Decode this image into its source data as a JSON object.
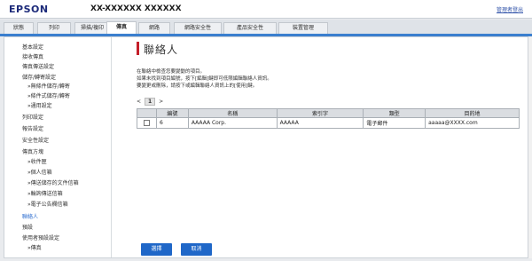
{
  "header": {
    "brand": "EPSON",
    "model": "XX-XXXXXX XXXXXX",
    "logout": "管理者登出"
  },
  "tabs": [
    {
      "label": "狀態"
    },
    {
      "label": "列印"
    },
    {
      "label": "掃描/複印"
    },
    {
      "label": "傳真"
    },
    {
      "label": "網路"
    },
    {
      "label": "網路安全性"
    },
    {
      "label": "產品安全性"
    },
    {
      "label": "裝置管理"
    }
  ],
  "sidebar": {
    "items": [
      {
        "label": "基本設定"
      },
      {
        "label": "接收傳真"
      },
      {
        "label": "傳真傳送設定"
      },
      {
        "label": "儲存/轉寄設定"
      },
      {
        "label": "»無條件儲存/轉寄"
      },
      {
        "label": "»條件式儲存/轉寄"
      },
      {
        "label": "»通用設定"
      },
      {
        "label": "列印設定"
      },
      {
        "label": "報告設定"
      },
      {
        "label": "安全性設定"
      },
      {
        "label": "傳真方塊"
      },
      {
        "label": "»收件匣"
      },
      {
        "label": "»個人信箱"
      },
      {
        "label": "»傳送儲存的文件信箱"
      },
      {
        "label": "»輪詢傳送信箱"
      },
      {
        "label": "»電子公告欄信箱"
      },
      {
        "label": "聯絡人"
      },
      {
        "label": "預設"
      },
      {
        "label": "使用者預設設定"
      },
      {
        "label": "»傳真"
      }
    ]
  },
  "main": {
    "title": "聯絡人",
    "desc": [
      "在聯絡中檢查您要變動的項目。",
      "如果未找到項目編號，按下[編輯]鍵即可低限編輯聯絡人資訊。",
      "要變更或刪除，請按下或編輯聯絡人資訊上的[使用]鍵。"
    ],
    "pager": {
      "prev": "<",
      "page": "1",
      "next": ">"
    },
    "table": {
      "headers": [
        "",
        "編號",
        "名稱",
        "索引字",
        "類型",
        "目的地"
      ],
      "rows": [
        {
          "checked": false,
          "number": "6",
          "name": "AAAAA Corp.",
          "index": "AAAAA",
          "type": "電子郵件",
          "destination": "aaaaa@XXXX.com"
        }
      ]
    },
    "buttons": {
      "select": "選擇",
      "cancel": "取消"
    }
  },
  "colors": {
    "accent": "#1f67c8",
    "tab_underline": "#3b7fcf",
    "title_mark": "#c41f2a",
    "brand": "#1d2b7a"
  }
}
